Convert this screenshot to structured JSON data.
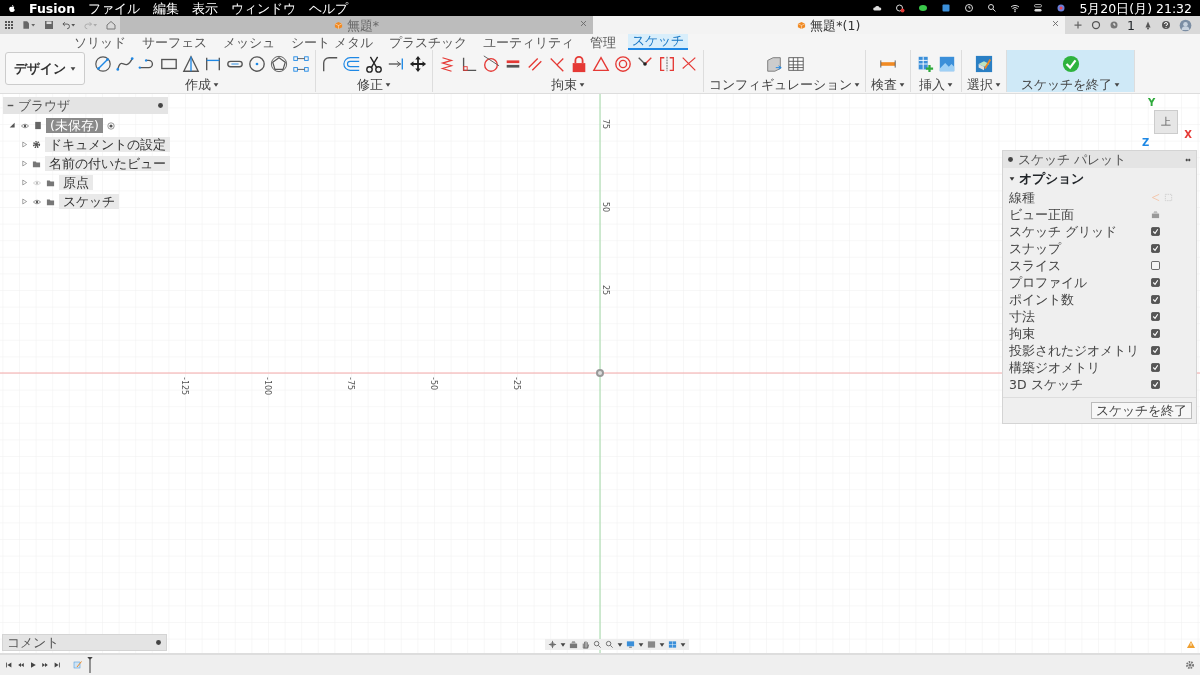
{
  "menu_bar": {
    "app": "Fusion",
    "items": [
      "ファイル",
      "編集",
      "表示",
      "ウィンドウ",
      "ヘルプ"
    ],
    "clock": "5月20日(月) 21:32"
  },
  "doc_tabs": [
    {
      "title": "無題*",
      "selected": false
    },
    {
      "title": "無題*(1)",
      "selected": true
    }
  ],
  "job_count": "1",
  "workspace": "デザイン",
  "ribbon_tabs": [
    {
      "label": "ソリッド",
      "selected": false
    },
    {
      "label": "サーフェス",
      "selected": false
    },
    {
      "label": "メッシュ",
      "selected": false
    },
    {
      "label": "シート メタル",
      "selected": false
    },
    {
      "label": "プラスチック",
      "selected": false
    },
    {
      "label": "ユーティリティ",
      "selected": false
    },
    {
      "label": "管理",
      "selected": false
    },
    {
      "label": "スケッチ",
      "selected": true
    }
  ],
  "tool_groups": [
    {
      "label": "作成",
      "kind": "create"
    },
    {
      "label": "修正",
      "kind": "modify"
    },
    {
      "label": "拘束",
      "kind": "constrain"
    },
    {
      "label": "コンフィギュレーション",
      "kind": "configure"
    },
    {
      "label": "検査",
      "kind": "inspect"
    },
    {
      "label": "挿入",
      "kind": "insert"
    },
    {
      "label": "選択",
      "kind": "select"
    },
    {
      "label": "スケッチを終了",
      "kind": "finish"
    }
  ],
  "browser": {
    "title": "ブラウザ",
    "root": {
      "label": "(未保存)",
      "expanded": true,
      "visible": true,
      "active": true,
      "children": [
        {
          "label": "ドキュメントの設定",
          "kind": "settings",
          "expanded": false
        },
        {
          "label": "名前の付いたビュー",
          "kind": "folder",
          "expanded": false
        },
        {
          "label": "原点",
          "kind": "folder",
          "expanded": false,
          "visible": false
        },
        {
          "label": "スケッチ",
          "kind": "folder",
          "expanded": false,
          "visible": true
        }
      ]
    }
  },
  "view_cube": {
    "face": "上",
    "axes": [
      {
        "label": "Y",
        "color": "#2eaa3c"
      },
      {
        "label": "X",
        "color": "#e53935"
      },
      {
        "label": "Z",
        "color": "#1e88e5"
      }
    ]
  },
  "axis_labels": {
    "vertical": [
      "75",
      "50",
      "25"
    ],
    "horizontal": [
      "-125",
      "-100",
      "-75",
      "-50",
      "-25"
    ]
  },
  "sketch_palette": {
    "title": "スケッチ パレット",
    "section": "オプション",
    "options": [
      {
        "label": "線種",
        "kind": "linetype"
      },
      {
        "label": "ビュー正面",
        "kind": "look"
      },
      {
        "label": "スケッチ グリッド",
        "kind": "checkbox",
        "checked": true
      },
      {
        "label": "スナップ",
        "kind": "checkbox",
        "checked": true
      },
      {
        "label": "スライス",
        "kind": "checkbox",
        "checked": false
      },
      {
        "label": "プロファイル",
        "kind": "checkbox",
        "checked": true
      },
      {
        "label": "ポイント数",
        "kind": "checkbox",
        "checked": true
      },
      {
        "label": "寸法",
        "kind": "checkbox",
        "checked": true
      },
      {
        "label": "拘束",
        "kind": "checkbox",
        "checked": true
      },
      {
        "label": "投影されたジオメトリ",
        "kind": "checkbox",
        "checked": true
      },
      {
        "label": "構築ジオメトリ",
        "kind": "checkbox",
        "checked": true
      },
      {
        "label": "3D スケッチ",
        "kind": "checkbox",
        "checked": true
      }
    ],
    "finish_button": "スケッチを終了"
  },
  "comments": {
    "title": "コメント"
  }
}
